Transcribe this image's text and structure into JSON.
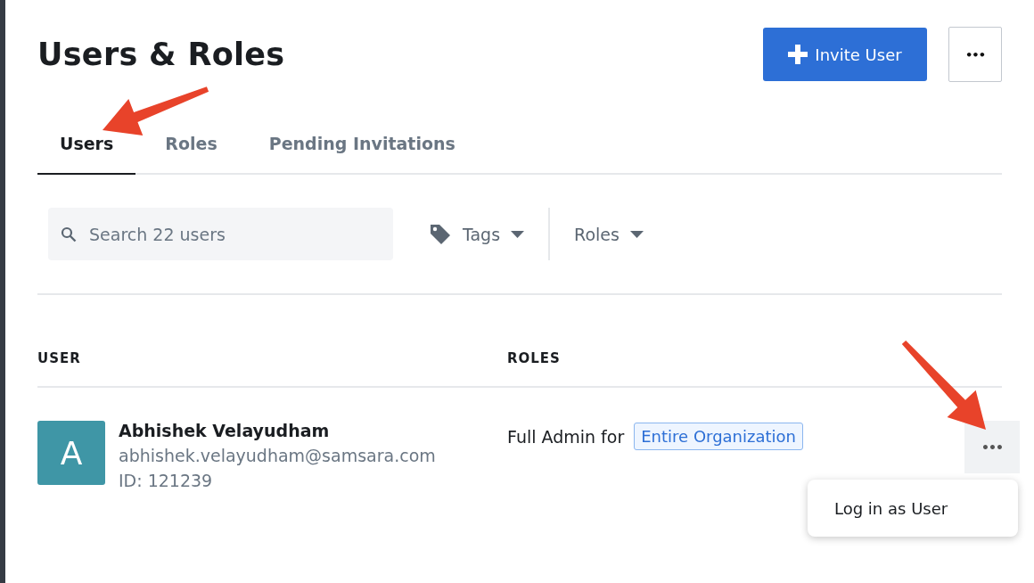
{
  "page": {
    "title": "Users & Roles"
  },
  "header_actions": {
    "invite_button": "Invite User",
    "more_button": "•••"
  },
  "tabs": [
    {
      "label": "Users",
      "selected": true
    },
    {
      "label": "Roles",
      "selected": false
    },
    {
      "label": "Pending Invitations",
      "selected": false
    }
  ],
  "search": {
    "placeholder": "Search 22 users"
  },
  "filters": [
    {
      "label": "Tags",
      "kind": "tag"
    },
    {
      "label": "Roles",
      "kind": "plain"
    }
  ],
  "table": {
    "columns": [
      "USER",
      "ROLES"
    ],
    "rows": [
      {
        "avatar": "A",
        "name": "Abhishek Velayudham",
        "email": "abhishek.velayudham@samsara.com",
        "id": "ID: 121239",
        "role": "Full Admin for",
        "scope": "Entire Organization",
        "action": "•••",
        "menu_open": true,
        "menu": [
          "Log in as User"
        ]
      }
    ]
  }
}
